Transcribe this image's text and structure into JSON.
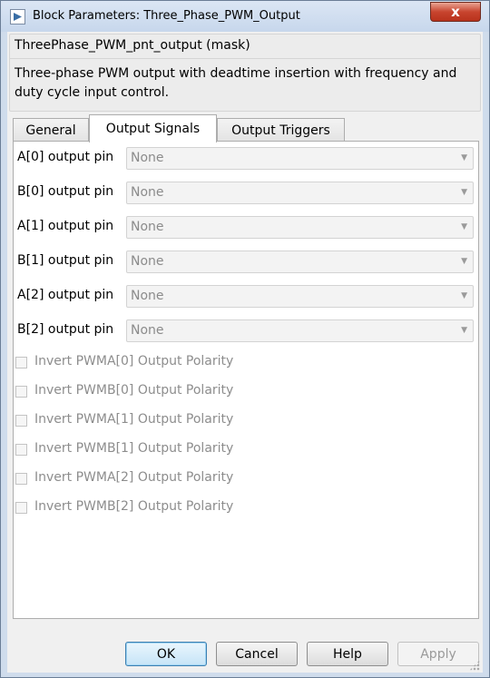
{
  "window": {
    "title": "Block Parameters: Three_Phase_PWM_Output",
    "close_glyph": "x",
    "app_icon": "simulink-block-icon"
  },
  "mask": {
    "title": "ThreePhase_PWM_pnt_output (mask)",
    "description": "Three-phase PWM output with deadtime insertion with frequency and duty cycle input control."
  },
  "tabs": [
    {
      "label": "General",
      "active": false
    },
    {
      "label": "Output Signals",
      "active": true
    },
    {
      "label": "Output Triggers",
      "active": false
    }
  ],
  "output_pins": [
    {
      "label": "A[0] output pin",
      "value": "None"
    },
    {
      "label": "B[0] output pin",
      "value": "None"
    },
    {
      "label": "A[1] output pin",
      "value": "None"
    },
    {
      "label": "B[1] output pin",
      "value": "None"
    },
    {
      "label": "A[2] output pin",
      "value": "None"
    },
    {
      "label": "B[2] output pin",
      "value": "None"
    }
  ],
  "polarity_checkboxes": [
    {
      "label": "Invert PWMA[0] Output Polarity",
      "checked": false,
      "enabled": false
    },
    {
      "label": "Invert PWMB[0] Output Polarity",
      "checked": false,
      "enabled": false
    },
    {
      "label": "Invert PWMA[1] Output Polarity",
      "checked": false,
      "enabled": false
    },
    {
      "label": "Invert PWMB[1] Output Polarity",
      "checked": false,
      "enabled": false
    },
    {
      "label": "Invert PWMA[2] Output Polarity",
      "checked": false,
      "enabled": false
    },
    {
      "label": "Invert PWMB[2] Output Polarity",
      "checked": false,
      "enabled": false
    }
  ],
  "buttons": {
    "ok": "OK",
    "cancel": "Cancel",
    "help": "Help",
    "apply": "Apply"
  },
  "colors": {
    "titlebar": "#c7d7ec",
    "close_button": "#c8452f",
    "disabled_text": "#8d8d8d"
  }
}
